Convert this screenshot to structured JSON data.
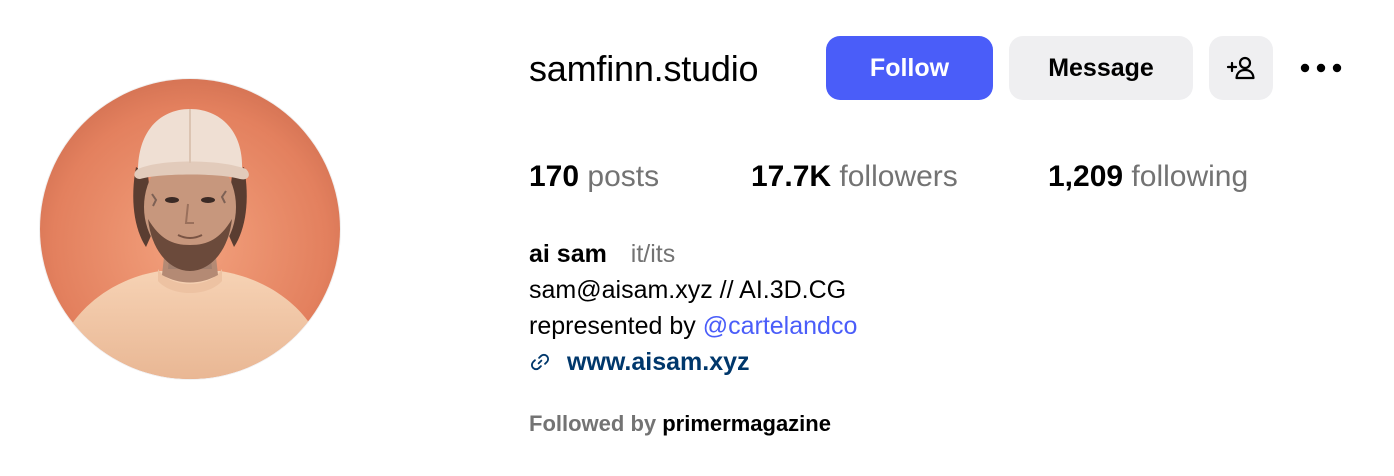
{
  "profile": {
    "username": "samfinn.studio",
    "avatar_icon": "profile-photo"
  },
  "actions": {
    "follow_label": "Follow",
    "message_label": "Message",
    "add_user_icon": "person-plus-icon",
    "more_icon": "more-options-icon"
  },
  "stats": {
    "posts_count": "170",
    "posts_label": "posts",
    "followers_count": "17.7K",
    "followers_label": "followers",
    "following_count": "1,209",
    "following_label": "following"
  },
  "bio": {
    "name": "ai sam",
    "pronouns": "it/its",
    "line1": "sam@aisam.xyz // AI.3D.CG",
    "line2_prefix": "represented by ",
    "mention": "@cartelandco",
    "link_icon": "link-icon",
    "link_text": "www.aisam.xyz"
  },
  "followed_by": {
    "prefix": "Followed by ",
    "user": "primermagazine"
  },
  "colors": {
    "accent": "#4a5df9",
    "secondary_button": "#efeff1",
    "muted_text": "#737373",
    "link": "#00376b"
  }
}
